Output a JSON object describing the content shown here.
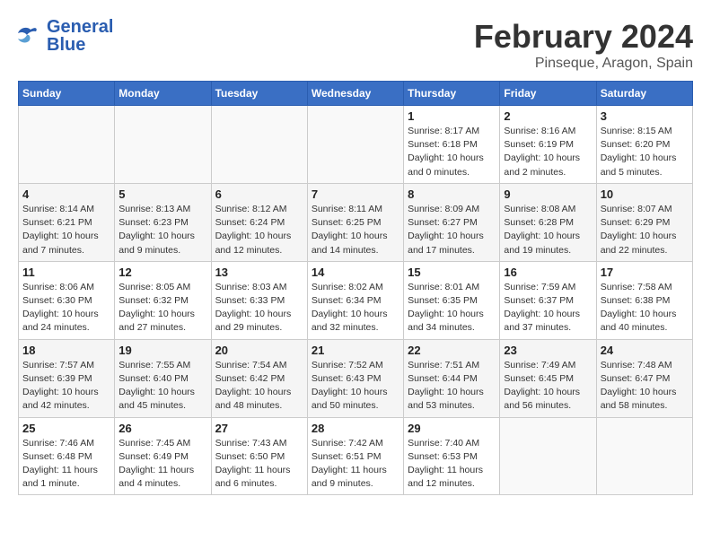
{
  "header": {
    "logo_line1": "General",
    "logo_line2": "Blue",
    "main_title": "February 2024",
    "subtitle": "Pinseque, Aragon, Spain"
  },
  "calendar": {
    "days_of_week": [
      "Sunday",
      "Monday",
      "Tuesday",
      "Wednesday",
      "Thursday",
      "Friday",
      "Saturday"
    ],
    "weeks": [
      [
        {
          "day": "",
          "info": ""
        },
        {
          "day": "",
          "info": ""
        },
        {
          "day": "",
          "info": ""
        },
        {
          "day": "",
          "info": ""
        },
        {
          "day": "1",
          "info": "Sunrise: 8:17 AM\nSunset: 6:18 PM\nDaylight: 10 hours\nand 0 minutes."
        },
        {
          "day": "2",
          "info": "Sunrise: 8:16 AM\nSunset: 6:19 PM\nDaylight: 10 hours\nand 2 minutes."
        },
        {
          "day": "3",
          "info": "Sunrise: 8:15 AM\nSunset: 6:20 PM\nDaylight: 10 hours\nand 5 minutes."
        }
      ],
      [
        {
          "day": "4",
          "info": "Sunrise: 8:14 AM\nSunset: 6:21 PM\nDaylight: 10 hours\nand 7 minutes."
        },
        {
          "day": "5",
          "info": "Sunrise: 8:13 AM\nSunset: 6:23 PM\nDaylight: 10 hours\nand 9 minutes."
        },
        {
          "day": "6",
          "info": "Sunrise: 8:12 AM\nSunset: 6:24 PM\nDaylight: 10 hours\nand 12 minutes."
        },
        {
          "day": "7",
          "info": "Sunrise: 8:11 AM\nSunset: 6:25 PM\nDaylight: 10 hours\nand 14 minutes."
        },
        {
          "day": "8",
          "info": "Sunrise: 8:09 AM\nSunset: 6:27 PM\nDaylight: 10 hours\nand 17 minutes."
        },
        {
          "day": "9",
          "info": "Sunrise: 8:08 AM\nSunset: 6:28 PM\nDaylight: 10 hours\nand 19 minutes."
        },
        {
          "day": "10",
          "info": "Sunrise: 8:07 AM\nSunset: 6:29 PM\nDaylight: 10 hours\nand 22 minutes."
        }
      ],
      [
        {
          "day": "11",
          "info": "Sunrise: 8:06 AM\nSunset: 6:30 PM\nDaylight: 10 hours\nand 24 minutes."
        },
        {
          "day": "12",
          "info": "Sunrise: 8:05 AM\nSunset: 6:32 PM\nDaylight: 10 hours\nand 27 minutes."
        },
        {
          "day": "13",
          "info": "Sunrise: 8:03 AM\nSunset: 6:33 PM\nDaylight: 10 hours\nand 29 minutes."
        },
        {
          "day": "14",
          "info": "Sunrise: 8:02 AM\nSunset: 6:34 PM\nDaylight: 10 hours\nand 32 minutes."
        },
        {
          "day": "15",
          "info": "Sunrise: 8:01 AM\nSunset: 6:35 PM\nDaylight: 10 hours\nand 34 minutes."
        },
        {
          "day": "16",
          "info": "Sunrise: 7:59 AM\nSunset: 6:37 PM\nDaylight: 10 hours\nand 37 minutes."
        },
        {
          "day": "17",
          "info": "Sunrise: 7:58 AM\nSunset: 6:38 PM\nDaylight: 10 hours\nand 40 minutes."
        }
      ],
      [
        {
          "day": "18",
          "info": "Sunrise: 7:57 AM\nSunset: 6:39 PM\nDaylight: 10 hours\nand 42 minutes."
        },
        {
          "day": "19",
          "info": "Sunrise: 7:55 AM\nSunset: 6:40 PM\nDaylight: 10 hours\nand 45 minutes."
        },
        {
          "day": "20",
          "info": "Sunrise: 7:54 AM\nSunset: 6:42 PM\nDaylight: 10 hours\nand 48 minutes."
        },
        {
          "day": "21",
          "info": "Sunrise: 7:52 AM\nSunset: 6:43 PM\nDaylight: 10 hours\nand 50 minutes."
        },
        {
          "day": "22",
          "info": "Sunrise: 7:51 AM\nSunset: 6:44 PM\nDaylight: 10 hours\nand 53 minutes."
        },
        {
          "day": "23",
          "info": "Sunrise: 7:49 AM\nSunset: 6:45 PM\nDaylight: 10 hours\nand 56 minutes."
        },
        {
          "day": "24",
          "info": "Sunrise: 7:48 AM\nSunset: 6:47 PM\nDaylight: 10 hours\nand 58 minutes."
        }
      ],
      [
        {
          "day": "25",
          "info": "Sunrise: 7:46 AM\nSunset: 6:48 PM\nDaylight: 11 hours\nand 1 minute."
        },
        {
          "day": "26",
          "info": "Sunrise: 7:45 AM\nSunset: 6:49 PM\nDaylight: 11 hours\nand 4 minutes."
        },
        {
          "day": "27",
          "info": "Sunrise: 7:43 AM\nSunset: 6:50 PM\nDaylight: 11 hours\nand 6 minutes."
        },
        {
          "day": "28",
          "info": "Sunrise: 7:42 AM\nSunset: 6:51 PM\nDaylight: 11 hours\nand 9 minutes."
        },
        {
          "day": "29",
          "info": "Sunrise: 7:40 AM\nSunset: 6:53 PM\nDaylight: 11 hours\nand 12 minutes."
        },
        {
          "day": "",
          "info": ""
        },
        {
          "day": "",
          "info": ""
        }
      ]
    ]
  }
}
